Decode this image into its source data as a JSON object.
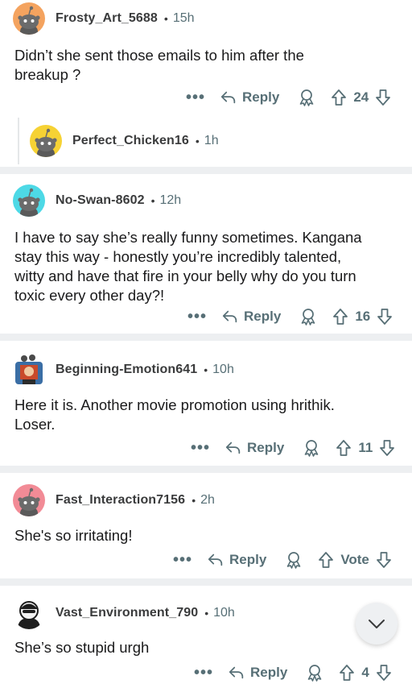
{
  "comments": [
    {
      "username": "Frosty_Art_5688",
      "time": "15h",
      "text_line1": "Didn’t she sent those emails to him after the",
      "text_line2": "breakup ?",
      "reply_label": "Reply",
      "votes": "24",
      "avatar_color": "#f4a35f"
    },
    {
      "username": "Perfect_Chicken16",
      "time": "1h",
      "avatar_color": "#f6d234"
    },
    {
      "username": "No-Swan-8602",
      "time": "12h",
      "text_line1": "I have to say she’s really funny sometimes. Kangana",
      "text_line2": "stay this way - honestly you’re incredibly talented,",
      "text_line3": "witty and have that fire in your belly why do you turn",
      "text_line4": "toxic every other day?!",
      "reply_label": "Reply",
      "votes": "16",
      "avatar_color": "#4dd9e6"
    },
    {
      "username": "Beginning-Emotion641",
      "time": "10h",
      "text_line1": "Here it is. Another movie promotion using hrithik.",
      "text_line2": "Loser.",
      "reply_label": "Reply",
      "votes": "11",
      "avatar_color": "#3a6ea5"
    },
    {
      "username": "Fast_Interaction7156",
      "time": "2h",
      "text_line1": "She's so irritating!",
      "reply_label": "Reply",
      "votes": "Vote",
      "avatar_color": "#f28b96"
    },
    {
      "username": "Vast_Environment_790",
      "time": "10h",
      "text_line1": "She’s so stupid urgh",
      "reply_label": "Reply",
      "votes": "4",
      "avatar_color": "#ffffff"
    }
  ],
  "separator": "•",
  "more_label": "•••",
  "icons": {
    "reply": "reply-arrow-icon",
    "award": "award-icon",
    "upvote": "upvote-arrow-icon",
    "downvote": "downvote-arrow-icon",
    "collapse": "chevron-down-icon"
  },
  "colors": {
    "meta_text": "#576f76",
    "body_text": "#1a1a1b",
    "separator_bg": "#edeff1"
  }
}
